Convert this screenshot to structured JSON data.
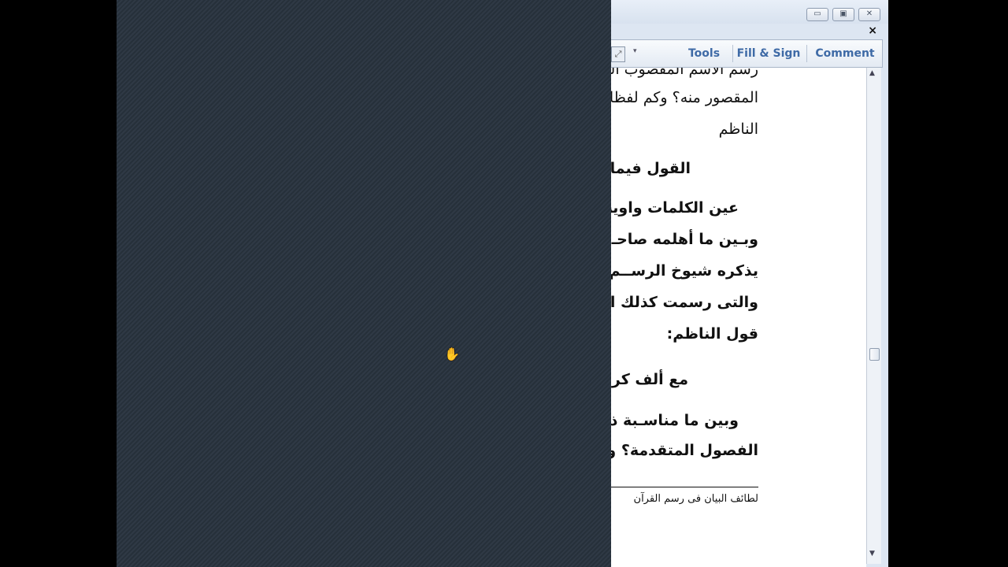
{
  "toolbar": {
    "tools_label": "Tools",
    "fill_sign_label": "Fill & Sign",
    "comment_label": "Comment"
  },
  "window": {
    "minimize": "▭",
    "maximize": "▣",
    "close": "✕",
    "doc_close": "×"
  },
  "document": {
    "lines": [
      "رسم الاسم المقصوب المنو",
      "المقصور منه؟ وكم لفظا و",
      "الناظم",
      "القول فيما ر",
      "عين الكلمات واوية ال",
      "وبـين ما أهلمه صاحـ",
      "يذكره شيوخ الرســم ،",
      "والتى رسمت كذلك اخت",
      "قول الناظم:",
      "مع ألف كرس",
      "وبين ما مناسـبة ذك",
      "الفصول المتقدمة؟ وما م"
    ],
    "footnote": "لطائف البيان فى رسم القرآن"
  },
  "colors": {
    "toolbar_text": "#3e6aa6",
    "wallpaper": "#2c3540"
  }
}
